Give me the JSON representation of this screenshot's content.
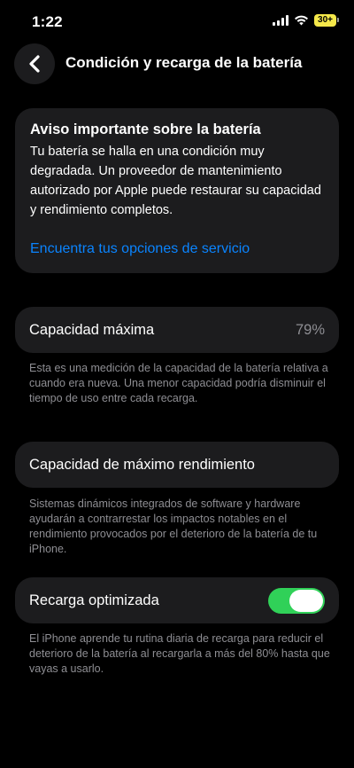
{
  "status_bar": {
    "time": "1:22",
    "battery_label": "30+",
    "icons": [
      "signal-icon",
      "wifi-icon",
      "battery-icon"
    ]
  },
  "nav": {
    "title": "Condición y recarga de la batería",
    "back_icon": "chevron-left-icon"
  },
  "notice": {
    "title": "Aviso importante sobre la batería",
    "body": "Tu batería se halla en una condición muy degradada. Un proveedor de mantenimiento autorizado por Apple puede restaurar su capacidad y rendimiento completos.",
    "link": "Encuentra tus opciones de servicio"
  },
  "max_capacity": {
    "label": "Capacidad máxima",
    "value": "79%",
    "footnote": "Esta es una medición de la capacidad de la batería relativa a cuando era nueva. Una menor capacidad podría disminuir el tiempo de uso entre cada recarga."
  },
  "peak_performance": {
    "label": "Capacidad de máximo rendimiento",
    "footnote": "Sistemas dinámicos integrados de software y hardware ayudarán a contrarrestar los impactos notables en el rendimiento provocados por el deterioro de la batería de tu iPhone."
  },
  "optimized_charging": {
    "label": "Recarga optimizada",
    "enabled": true,
    "footnote": "El iPhone aprende tu rutina diaria de recarga para reducir el deterioro de la batería al recargarla a más del 80% hasta que vayas a usarlo."
  },
  "colors": {
    "background": "#000000",
    "card": "#1c1c1e",
    "link": "#0a84ff",
    "toggle_on": "#30d158",
    "secondary_text": "#8e8e93",
    "battery_indicator": "#f5e84a"
  }
}
